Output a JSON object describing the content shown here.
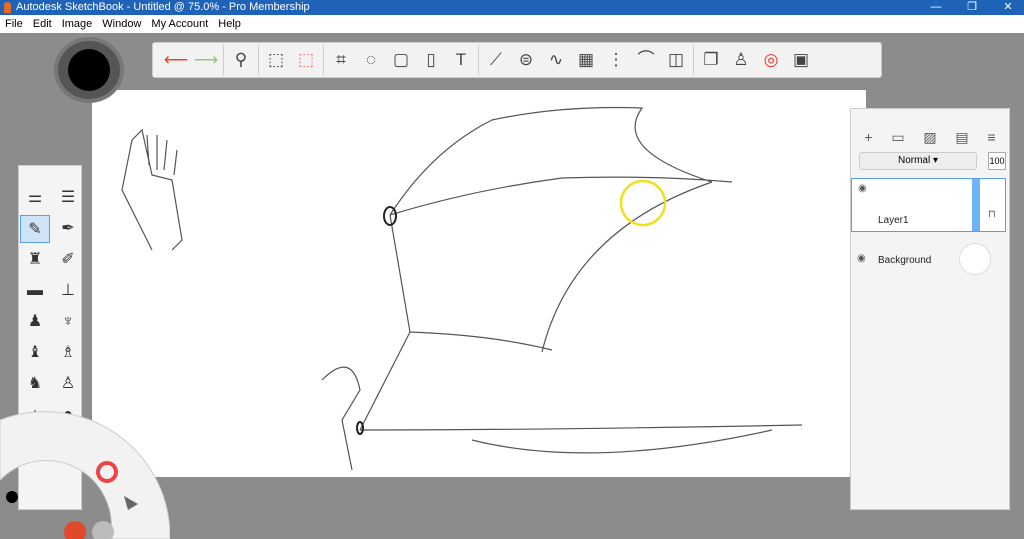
{
  "window": {
    "title": "Autodesk SketchBook - Untitled @ 75.0% - Pro Membership"
  },
  "menu": [
    "File",
    "Edit",
    "Image",
    "Window",
    "My Account",
    "Help"
  ],
  "toolbar": {
    "icons": [
      "undo-icon",
      "redo-icon",
      "zoom-icon",
      "select-icon",
      "crop-mask-icon",
      "crop-icon",
      "lasso-icon",
      "transform-icon",
      "fill-icon",
      "text-icon",
      "ruler-icon",
      "ellipse-icon",
      "french-curve-icon",
      "perspective-icon",
      "symmetry-icon",
      "stroke-icon",
      "shape-icon",
      "copy-icon",
      "brushes-icon",
      "color-wheel-icon",
      "palette-icon"
    ]
  },
  "layers": {
    "blend_mode": "Normal",
    "opacity": "100",
    "items": [
      {
        "name": "Layer1"
      },
      {
        "name": "Background"
      }
    ]
  }
}
